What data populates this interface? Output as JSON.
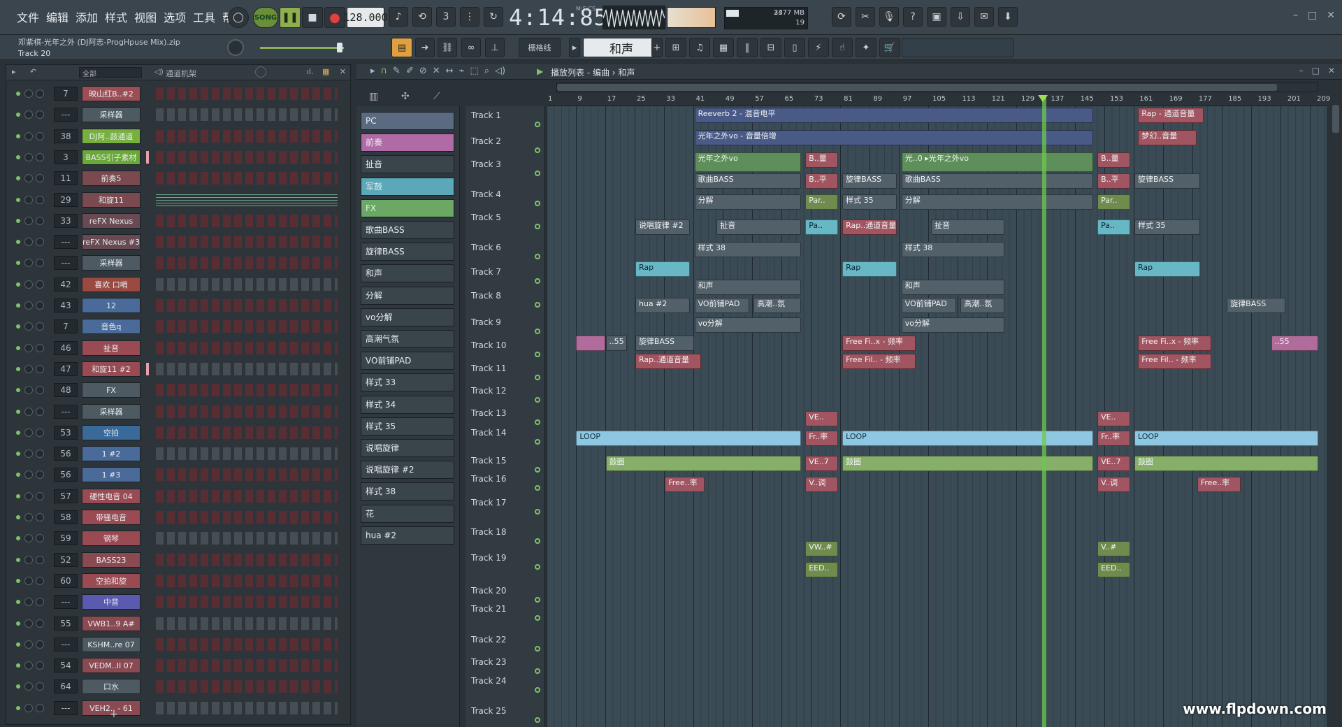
{
  "menu": [
    "文件",
    "编辑",
    "添加",
    "样式",
    "视图",
    "选项",
    "工具",
    "帮助"
  ],
  "transport": {
    "song_label": "SONG",
    "tempo": "128.000",
    "time": "4:14:85",
    "time_unit": "M:S:CS",
    "cpu": "23",
    "memory": "3477 MB",
    "polyphony": "19"
  },
  "project": {
    "filename": "邓紫棋-光年之外 (DJ阿志-ProgHpuse Mix).zip",
    "hint": "Track 20"
  },
  "toolbar2": {
    "snap": "栅格线",
    "pattern": "和声"
  },
  "rack": {
    "filter": "全部",
    "title": "通道机架",
    "rows": [
      {
        "num": "7",
        "name": "映山红B..#2",
        "color": "#9c4e57"
      },
      {
        "num": "---",
        "name": "采样器",
        "color": "#4e5a62"
      },
      {
        "num": "38",
        "name": "DJ阿..鼓通道",
        "color": "#78b040"
      },
      {
        "num": "3",
        "name": "BASS引子素材",
        "color": "#6aa83a"
      },
      {
        "num": "11",
        "name": "前奏5",
        "color": "#7a4a50"
      },
      {
        "num": "29",
        "name": "和旋11",
        "color": "#7a4a50"
      },
      {
        "num": "33",
        "name": "reFX Nexus",
        "color": "#6a4a52"
      },
      {
        "num": "---",
        "name": "reFX Nexus #3",
        "color": "#6a4a52"
      },
      {
        "num": "---",
        "name": "采样器",
        "color": "#4e5a62"
      },
      {
        "num": "42",
        "name": "喜欢 口哨",
        "color": "#9a4a40"
      },
      {
        "num": "43",
        "name": "12",
        "color": "#4a6a9a"
      },
      {
        "num": "7",
        "name": "音色q",
        "color": "#4a6a9a"
      },
      {
        "num": "46",
        "name": "扯音",
        "color": "#9a4a52"
      },
      {
        "num": "47",
        "name": "和旋11 #2",
        "color": "#9a4a52"
      },
      {
        "num": "48",
        "name": "FX",
        "color": "#4e5a62"
      },
      {
        "num": "---",
        "name": "采样器",
        "color": "#4e5a62"
      },
      {
        "num": "53",
        "name": "空拍",
        "color": "#3a6a9a"
      },
      {
        "num": "56",
        "name": "1 #2",
        "color": "#4a6a9a"
      },
      {
        "num": "56",
        "name": "1 #3",
        "color": "#4a6a9a"
      },
      {
        "num": "57",
        "name": "硬性电音 04",
        "color": "#9a4a52"
      },
      {
        "num": "58",
        "name": "带骚电音",
        "color": "#9a4a52"
      },
      {
        "num": "59",
        "name": "钢琴",
        "color": "#9a4a52"
      },
      {
        "num": "52",
        "name": "BASS23",
        "color": "#8a4a52"
      },
      {
        "num": "60",
        "name": "空拍和旋",
        "color": "#9a4a52"
      },
      {
        "num": "---",
        "name": "中音",
        "color": "#5a5ab0"
      },
      {
        "num": "55",
        "name": "VWB1..9 A#",
        "color": "#8a4a52"
      },
      {
        "num": "---",
        "name": "KSHM..re 07",
        "color": "#4e5a62"
      },
      {
        "num": "54",
        "name": "VEDM..II 07",
        "color": "#8a4a52"
      },
      {
        "num": "64",
        "name": "口水",
        "color": "#4e5a62"
      },
      {
        "num": "---",
        "name": "VEH2.. - 61",
        "color": "#8a4a52"
      }
    ]
  },
  "picker": [
    {
      "label": "PC",
      "color": "#5a6a80"
    },
    {
      "label": "前奏",
      "color": "#b06aa6"
    },
    {
      "label": "扯音",
      "color": "#3a444b"
    },
    {
      "label": "军鼓",
      "color": "#5aa8b8"
    },
    {
      "label": "FX",
      "color": "#6aa864"
    },
    {
      "label": "歌曲BASS",
      "color": "#3a444b"
    },
    {
      "label": "旋律BASS",
      "color": "#3a444b"
    },
    {
      "label": "和声",
      "color": "#3a444b"
    },
    {
      "label": "分解",
      "color": "#3a444b"
    },
    {
      "label": "vo分解",
      "color": "#3a444b"
    },
    {
      "label": "高潮气氛",
      "color": "#3a444b"
    },
    {
      "label": "VO前铺PAD",
      "color": "#3a444b"
    },
    {
      "label": "样式 33",
      "color": "#3a444b"
    },
    {
      "label": "样式 34",
      "color": "#3a444b"
    },
    {
      "label": "样式 35",
      "color": "#3a444b"
    },
    {
      "label": "说唱旋律",
      "color": "#3a444b"
    },
    {
      "label": "说唱旋律 #2",
      "color": "#3a444b"
    },
    {
      "label": "样式 38",
      "color": "#3a444b"
    },
    {
      "label": "花",
      "color": "#3a444b"
    },
    {
      "label": "hua #2",
      "color": "#3a444b"
    }
  ],
  "playlist": {
    "title": "播放列表 - 编曲 › 和声",
    "ruler": [
      "1",
      "9",
      "17",
      "25",
      "33",
      "41",
      "49",
      "57",
      "65",
      "73",
      "81",
      "89",
      "97",
      "105",
      "113",
      "121",
      "129",
      "137",
      "145",
      "153",
      "161",
      "169",
      "177",
      "185",
      "193",
      "201",
      "209"
    ],
    "tracks": [
      "Track 1",
      "Track 2",
      "Track 3",
      "Track 4",
      "Track 5",
      "Track 6",
      "Track 7",
      "Track 8",
      "Track 9",
      "Track 10",
      "Track 11",
      "Track 12",
      "Track 13",
      "Track 14",
      "Track 15",
      "Track 16",
      "Track 17",
      "Track 18",
      "Track 19",
      "Track 20",
      "Track 21",
      "Track 22",
      "Track 23",
      "Track 24",
      "Track 25"
    ],
    "clips": [
      {
        "t": 0,
        "s": 41,
        "e": 149,
        "label": "Reeverb 2 - 混音电平",
        "c": "c-blue"
      },
      {
        "t": 0,
        "s": 161,
        "e": 179,
        "label": "Rap - 通道音量",
        "c": "c-red"
      },
      {
        "t": 1,
        "s": 41,
        "e": 149,
        "label": "光年之外vo - 音量倍增",
        "c": "c-blue"
      },
      {
        "t": 1,
        "s": 161,
        "e": 177,
        "label": "梦幻..音量",
        "c": "c-red"
      },
      {
        "t": 2,
        "s": 41,
        "e": 70,
        "label": "光年之外vo",
        "c": "c-green",
        "w": 1
      },
      {
        "t": 2,
        "s": 71,
        "e": 80,
        "label": "B..量",
        "c": "c-red"
      },
      {
        "t": 2,
        "s": 97,
        "e": 149,
        "label": "光..0 ▸光年之外vo",
        "c": "c-green",
        "w": 1
      },
      {
        "t": 2,
        "s": 150,
        "e": 159,
        "label": "B..量",
        "c": "c-red"
      },
      {
        "t": 3,
        "s": 41,
        "e": 70,
        "label": "歌曲BASS",
        "c": "c-gray"
      },
      {
        "t": 3,
        "s": 71,
        "e": 80,
        "label": "B..平",
        "c": "c-red"
      },
      {
        "t": 3,
        "s": 81,
        "e": 96,
        "label": "旋律BASS",
        "c": "c-gray"
      },
      {
        "t": 3,
        "s": 97,
        "e": 149,
        "label": "歌曲BASS",
        "c": "c-gray"
      },
      {
        "t": 3,
        "s": 150,
        "e": 159,
        "label": "B..平",
        "c": "c-red"
      },
      {
        "t": 3,
        "s": 160,
        "e": 178,
        "label": "旋律BASS",
        "c": "c-gray"
      },
      {
        "t": 4,
        "s": 41,
        "e": 70,
        "label": "分解",
        "c": "c-gray"
      },
      {
        "t": 4,
        "s": 71,
        "e": 80,
        "label": "Par..",
        "c": "c-olive"
      },
      {
        "t": 4,
        "s": 81,
        "e": 96,
        "label": "样式 35",
        "c": "c-gray"
      },
      {
        "t": 4,
        "s": 97,
        "e": 149,
        "label": "分解",
        "c": "c-gray"
      },
      {
        "t": 4,
        "s": 150,
        "e": 159,
        "label": "Par..",
        "c": "c-olive"
      },
      {
        "t": 5,
        "s": 25,
        "e": 40,
        "label": "说唱旋律 #2",
        "c": "c-gray"
      },
      {
        "t": 5,
        "s": 47,
        "e": 70,
        "label": "扯音",
        "c": "c-gray"
      },
      {
        "t": 5,
        "s": 71,
        "e": 80,
        "label": "Pa..",
        "c": "c-teal"
      },
      {
        "t": 5,
        "s": 81,
        "e": 96,
        "label": "Rap..通道音量",
        "c": "c-red"
      },
      {
        "t": 5,
        "s": 105,
        "e": 125,
        "label": "扯音",
        "c": "c-gray"
      },
      {
        "t": 5,
        "s": 150,
        "e": 159,
        "label": "Pa..",
        "c": "c-teal"
      },
      {
        "t": 5,
        "s": 160,
        "e": 178,
        "label": "样式 35",
        "c": "c-gray"
      },
      {
        "t": 6,
        "s": 41,
        "e": 70,
        "label": "样式 38",
        "c": "c-gray"
      },
      {
        "t": 6,
        "s": 97,
        "e": 125,
        "label": "样式 38",
        "c": "c-gray"
      },
      {
        "t": 7,
        "s": 25,
        "e": 40,
        "label": "Rap",
        "c": "c-teal"
      },
      {
        "t": 7,
        "s": 81,
        "e": 96,
        "label": "Rap",
        "c": "c-teal"
      },
      {
        "t": 7,
        "s": 160,
        "e": 178,
        "label": "Rap",
        "c": "c-teal"
      },
      {
        "t": 8,
        "s": 41,
        "e": 70,
        "label": "和声",
        "c": "c-gray"
      },
      {
        "t": 8,
        "s": 97,
        "e": 125,
        "label": "和声",
        "c": "c-gray"
      },
      {
        "t": 9,
        "s": 25,
        "e": 40,
        "label": "hua #2",
        "c": "c-gray"
      },
      {
        "t": 9,
        "s": 41,
        "e": 56,
        "label": "VO前铺PAD",
        "c": "c-gray"
      },
      {
        "t": 9,
        "s": 57,
        "e": 70,
        "label": "高潮..氛",
        "c": "c-gray"
      },
      {
        "t": 9,
        "s": 97,
        "e": 112,
        "label": "VO前铺PAD",
        "c": "c-gray"
      },
      {
        "t": 9,
        "s": 113,
        "e": 125,
        "label": "高潮..氛",
        "c": "c-gray"
      },
      {
        "t": 9,
        "s": 185,
        "e": 201,
        "label": "旋律BASS",
        "c": "c-gray"
      },
      {
        "t": 10,
        "s": 41,
        "e": 70,
        "label": "vo分解",
        "c": "c-gray"
      },
      {
        "t": 10,
        "s": 97,
        "e": 125,
        "label": "vo分解",
        "c": "c-gray"
      },
      {
        "t": 11,
        "s": 9,
        "e": 17,
        "label": "",
        "c": "c-pink"
      },
      {
        "t": 11,
        "s": 17,
        "e": 23,
        "label": "..55",
        "c": "c-gray"
      },
      {
        "t": 11,
        "s": 25,
        "e": 41,
        "label": "旋律BASS",
        "c": "c-gray"
      },
      {
        "t": 11,
        "s": 81,
        "e": 101,
        "label": "Free Fi..x - 频率",
        "c": "c-red"
      },
      {
        "t": 11,
        "s": 161,
        "e": 181,
        "label": "Free Fi..x - 频率",
        "c": "c-red"
      },
      {
        "t": 11,
        "s": 197,
        "e": 210,
        "label": "..55",
        "c": "c-pink"
      },
      {
        "t": 12,
        "s": 25,
        "e": 43,
        "label": "Rap..通道音量",
        "c": "c-red"
      },
      {
        "t": 12,
        "s": 81,
        "e": 101,
        "label": "Free Fil.. - 频率",
        "c": "c-red"
      },
      {
        "t": 12,
        "s": 161,
        "e": 181,
        "label": "Free Fil.. - 频率",
        "c": "c-red"
      },
      {
        "t": 15,
        "s": 71,
        "e": 80,
        "label": "VE..",
        "c": "c-red"
      },
      {
        "t": 15,
        "s": 150,
        "e": 159,
        "label": "VE..",
        "c": "c-red"
      },
      {
        "t": 16,
        "s": 9,
        "e": 70,
        "label": "LOOP",
        "c": "c-sky"
      },
      {
        "t": 16,
        "s": 71,
        "e": 80,
        "label": "Fr..率",
        "c": "c-red"
      },
      {
        "t": 16,
        "s": 81,
        "e": 149,
        "label": "LOOP",
        "c": "c-sky"
      },
      {
        "t": 16,
        "s": 150,
        "e": 159,
        "label": "Fr..率",
        "c": "c-red"
      },
      {
        "t": 16,
        "s": 160,
        "e": 210,
        "label": "LOOP",
        "c": "c-sky"
      },
      {
        "t": 17,
        "s": 17,
        "e": 70,
        "label": "鼓圈",
        "c": "c-lime"
      },
      {
        "t": 17,
        "s": 71,
        "e": 80,
        "label": "VE..7",
        "c": "c-red"
      },
      {
        "t": 17,
        "s": 81,
        "e": 149,
        "label": "鼓圈",
        "c": "c-lime"
      },
      {
        "t": 17,
        "s": 150,
        "e": 159,
        "label": "VE..7",
        "c": "c-red"
      },
      {
        "t": 17,
        "s": 160,
        "e": 210,
        "label": "鼓圈",
        "c": "c-lime"
      },
      {
        "t": 18,
        "s": 33,
        "e": 44,
        "label": "Free..率",
        "c": "c-red"
      },
      {
        "t": 18,
        "s": 71,
        "e": 80,
        "label": "V..调",
        "c": "c-red"
      },
      {
        "t": 18,
        "s": 150,
        "e": 159,
        "label": "V..调",
        "c": "c-red"
      },
      {
        "t": 18,
        "s": 177,
        "e": 189,
        "label": "Free..率",
        "c": "c-red"
      },
      {
        "t": 21,
        "s": 71,
        "e": 80,
        "label": "VW..#",
        "c": "c-olive"
      },
      {
        "t": 21,
        "s": 150,
        "e": 159,
        "label": "V..#",
        "c": "c-olive"
      },
      {
        "t": 22,
        "s": 71,
        "e": 80,
        "label": "EED..",
        "c": "c-olive"
      },
      {
        "t": 22,
        "s": 150,
        "e": 159,
        "label": "EED..",
        "c": "c-olive"
      }
    ]
  },
  "watermark": "www.flpdown.com"
}
